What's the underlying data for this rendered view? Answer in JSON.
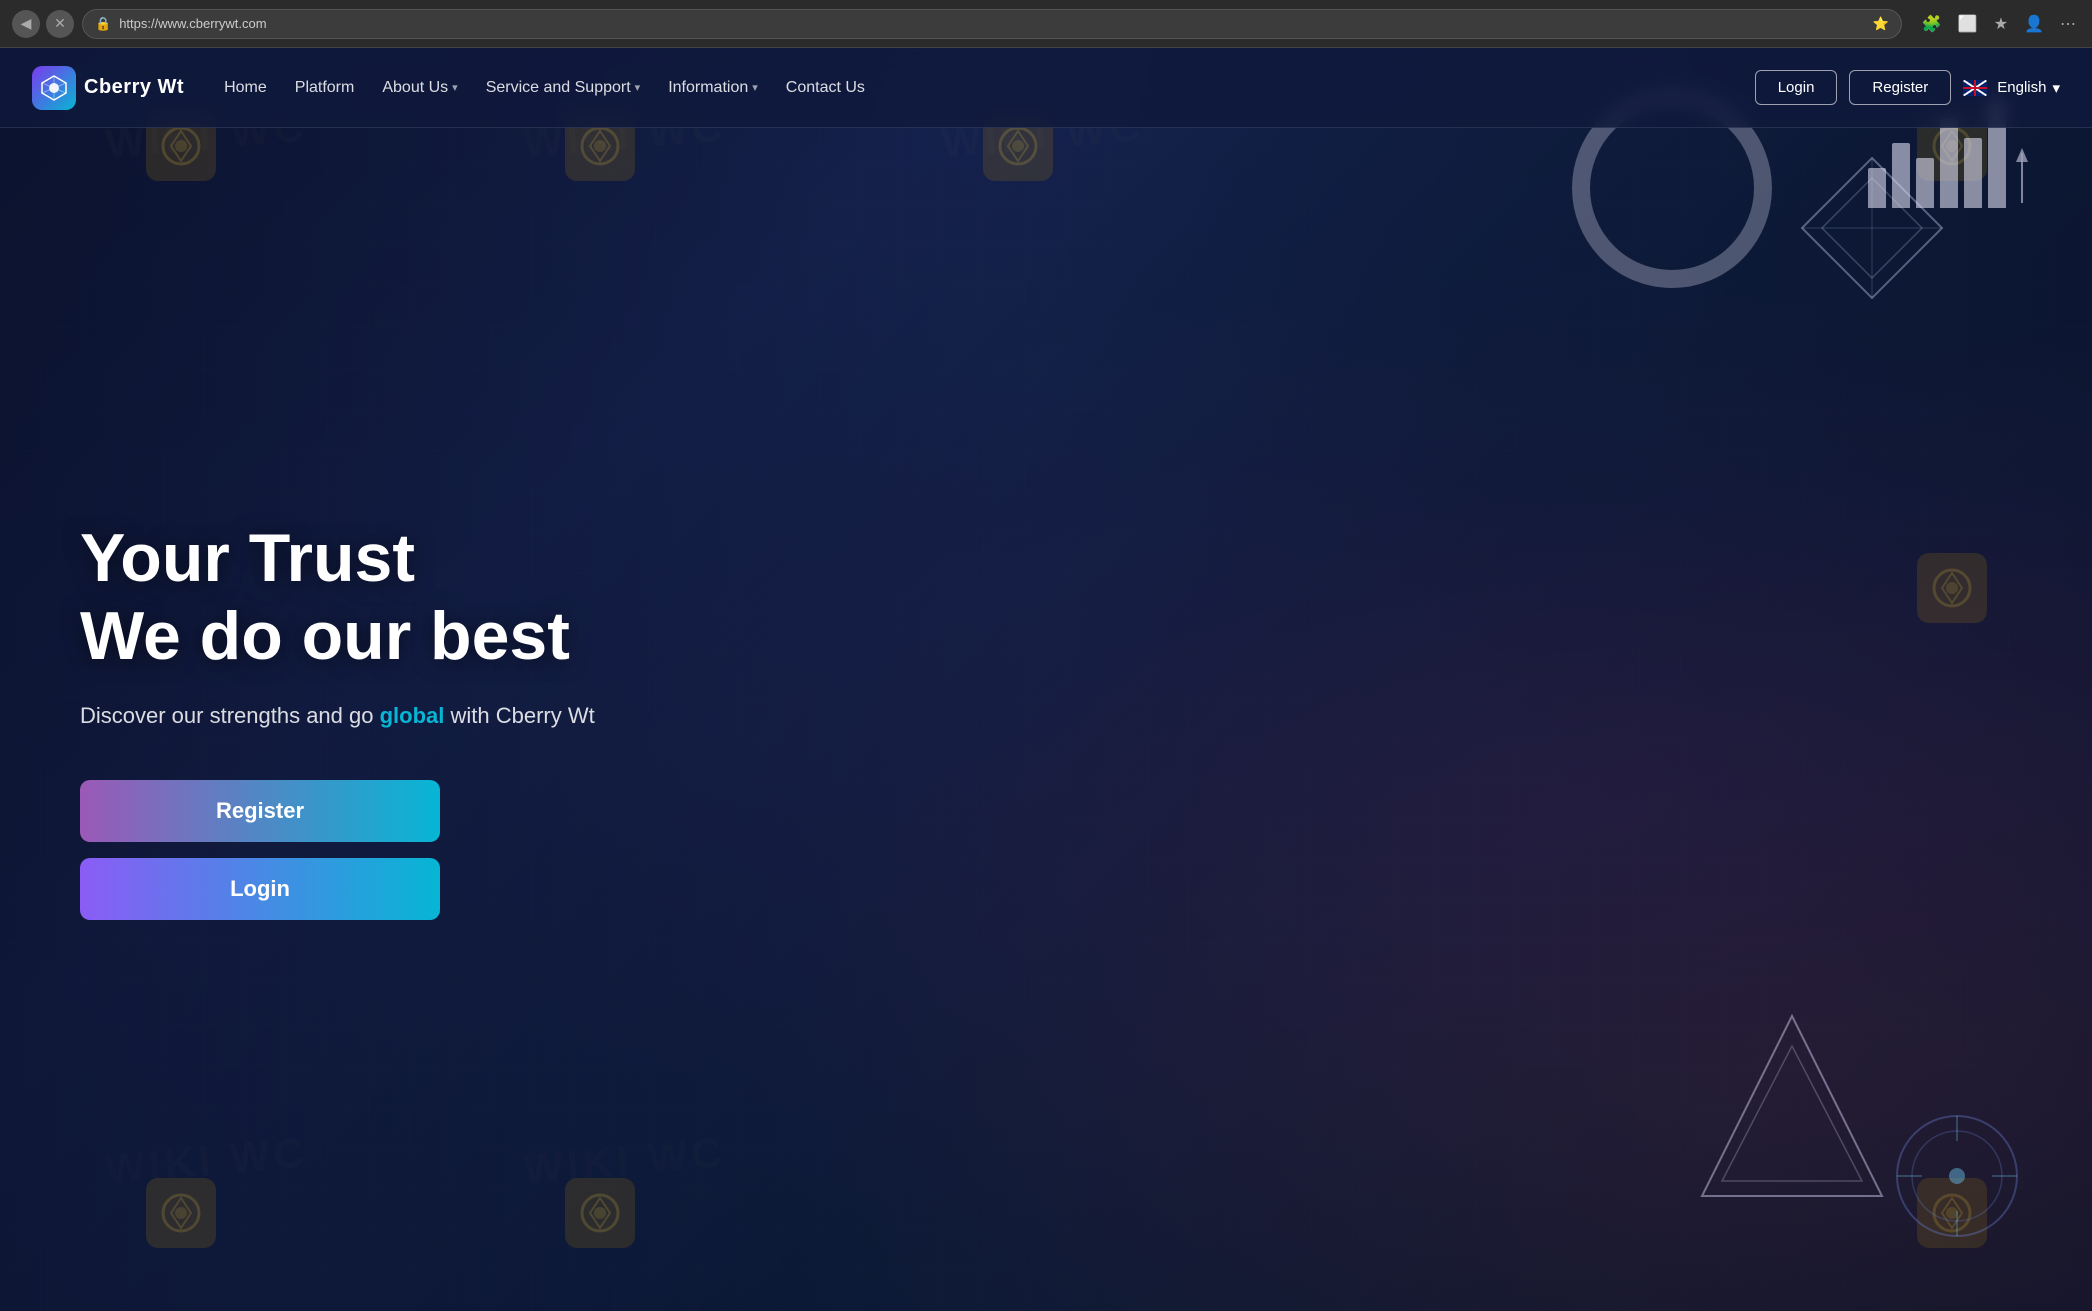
{
  "browser": {
    "url": "https://www.cberrywt.com",
    "back_icon": "◀",
    "close_icon": "✕",
    "refresh_icon": "↻"
  },
  "navbar": {
    "brand": {
      "logo_icon": "◈",
      "name": "Cberry Wt"
    },
    "nav_links": [
      {
        "label": "Home",
        "has_dropdown": false
      },
      {
        "label": "Platform",
        "has_dropdown": false
      },
      {
        "label": "About Us",
        "has_dropdown": true
      },
      {
        "label": "Service and Support",
        "has_dropdown": true
      },
      {
        "label": "Information",
        "has_dropdown": true
      },
      {
        "label": "Contact Us",
        "has_dropdown": false
      }
    ],
    "login_label": "Login",
    "register_label": "Register",
    "language": {
      "label": "English",
      "chevron": "▾"
    }
  },
  "hero": {
    "title_line1": "Your Trust",
    "title_line2": "We do our best",
    "subtitle_prefix": "Discover our strengths and go ",
    "subtitle_highlight": "global",
    "subtitle_suffix": " with Cberry Wt",
    "register_btn": "Register",
    "login_btn": "Login"
  },
  "watermarks": {
    "text": "WIKI WC",
    "logo_symbol": "◈"
  },
  "colors": {
    "bg_dark": "#0d1b3e",
    "accent_purple": "#8b5cf6",
    "accent_cyan": "#06b6d4",
    "highlight": "#06b6d4",
    "gold": "#c9a227"
  }
}
